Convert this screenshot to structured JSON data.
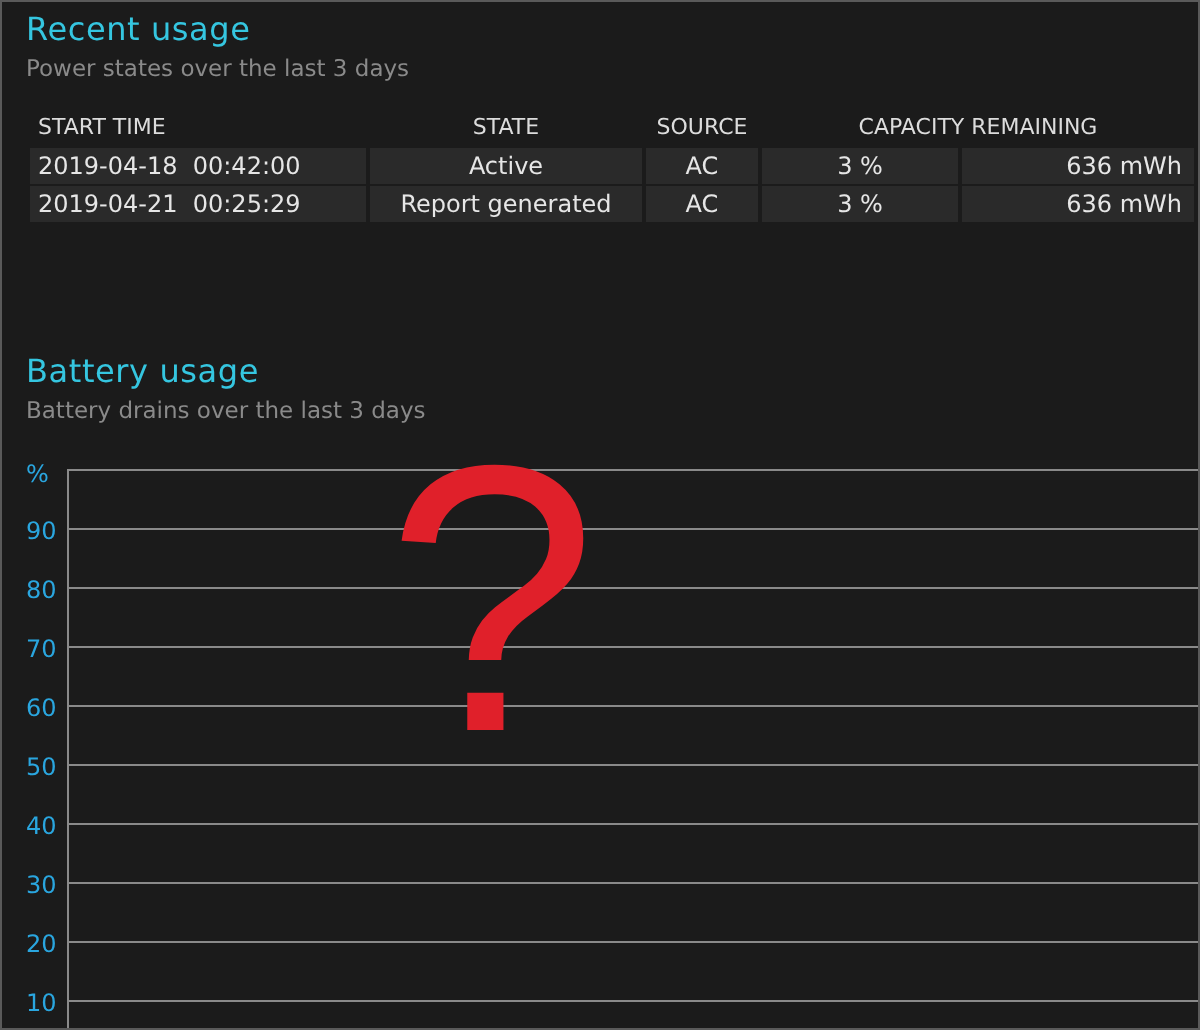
{
  "recent_usage": {
    "title": "Recent usage",
    "subtitle": "Power states over the last 3 days",
    "columns": [
      "START TIME",
      "STATE",
      "SOURCE",
      "CAPACITY REMAINING"
    ],
    "rows": [
      {
        "start_time": "2019-04-18  00:42:00",
        "state": "Active",
        "source": "AC",
        "percent": "3 %",
        "energy": "636 mWh"
      },
      {
        "start_time": "2019-04-21  00:25:29",
        "state": "Report generated",
        "source": "AC",
        "percent": "3 %",
        "energy": "636 mWh"
      }
    ]
  },
  "battery_usage": {
    "title": "Battery usage",
    "subtitle": "Battery drains over the last 3 days",
    "axis_unit": "%",
    "axis_ticks": [
      "90",
      "80",
      "70",
      "60",
      "50",
      "40",
      "30",
      "20",
      "10"
    ]
  },
  "annotation": "?"
}
